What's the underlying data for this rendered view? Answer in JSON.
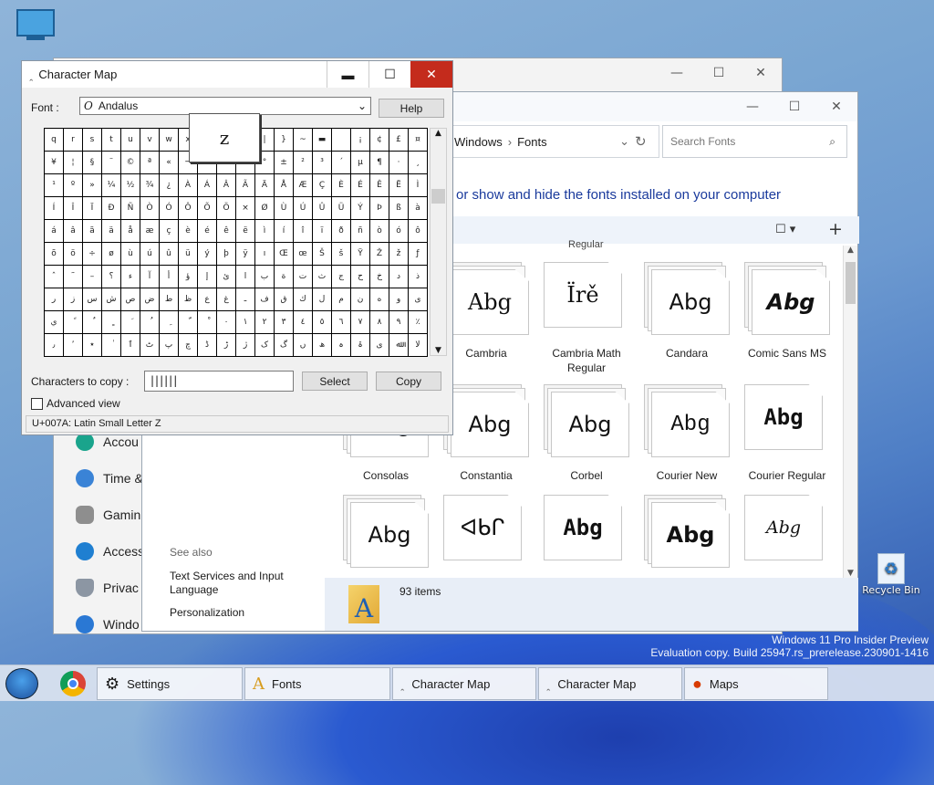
{
  "desktop": {
    "icons": [
      {
        "name": "This PC"
      },
      {
        "name": "Recycle Bin"
      }
    ],
    "watermark": {
      "line1": "Windows 11 Pro Insider Preview",
      "line2": "Evaluation copy. Build 25947.rs_prerelease.230901-1416"
    }
  },
  "settings_window": {
    "nav": [
      {
        "label": "Accou"
      },
      {
        "label": "Time &"
      },
      {
        "label": "Gamin"
      },
      {
        "label": "Access"
      },
      {
        "label": "Privac"
      },
      {
        "label": "Windo"
      }
    ]
  },
  "fonts_window": {
    "breadcrumb": [
      "Windows",
      "Fonts"
    ],
    "search_placeholder": "Search Fonts",
    "heading": "or show and hide the fonts installed on your computer",
    "partial_label": "Regular",
    "fonts": [
      {
        "sample": "Abg",
        "name": "Cambria"
      },
      {
        "sample": "Ïrě",
        "name": "Cambria Math Regular"
      },
      {
        "sample": "Abg",
        "name": "Candara"
      },
      {
        "sample": "Abg",
        "name": "Comic Sans MS"
      },
      {
        "sample": "Abg",
        "name": "Consolas"
      },
      {
        "sample": "Abg",
        "name": "Constantia"
      },
      {
        "sample": "Abg",
        "name": "Corbel"
      },
      {
        "sample": "Abg",
        "name": "Courier New"
      },
      {
        "sample": "Abg",
        "name": "Courier Regular"
      },
      {
        "sample": "Abg",
        "name": ""
      },
      {
        "sample": "ᐊᑲᒋ",
        "name": ""
      },
      {
        "sample": "Abg",
        "name": ""
      },
      {
        "sample": "Abg",
        "name": ""
      },
      {
        "sample": "Abg",
        "name": ""
      }
    ],
    "see_also": {
      "title": "See also",
      "links": [
        "Text Services and Input Language",
        "Personalization"
      ]
    },
    "status_count": "93 items"
  },
  "charmap": {
    "title": "Character Map",
    "font_label": "Font :",
    "font_value": "Andalus",
    "help": "Help",
    "zoom_char": "z",
    "grid": [
      [
        "q",
        "r",
        "s",
        "t",
        "u",
        "v",
        "w",
        "x",
        "y",
        "z",
        "{",
        "|",
        "}",
        "~",
        "▬",
        "",
        "¡",
        "¢",
        "£",
        "¤"
      ],
      [
        "¥",
        "¦",
        "§",
        "¨",
        "©",
        "ª",
        "«",
        "¬",
        "-",
        "®",
        "¯",
        "°",
        "±",
        "²",
        "³",
        "´",
        "µ",
        "¶",
        "·",
        "¸"
      ],
      [
        "¹",
        "º",
        "»",
        "¼",
        "½",
        "¾",
        "¿",
        "À",
        "Á",
        "Â",
        "Ã",
        "Ä",
        "Å",
        "Æ",
        "Ç",
        "È",
        "É",
        "Ê",
        "Ë",
        "Ì"
      ],
      [
        "Í",
        "Î",
        "Ï",
        "Ð",
        "Ñ",
        "Ò",
        "Ó",
        "Ô",
        "Õ",
        "Ö",
        "×",
        "Ø",
        "Ù",
        "Ú",
        "Û",
        "Ü",
        "Ý",
        "Þ",
        "ß",
        "à"
      ],
      [
        "á",
        "â",
        "ã",
        "ä",
        "å",
        "æ",
        "ç",
        "è",
        "é",
        "ê",
        "ë",
        "ì",
        "í",
        "î",
        "ï",
        "ð",
        "ñ",
        "ò",
        "ó",
        "ô"
      ],
      [
        "õ",
        "ö",
        "÷",
        "ø",
        "ù",
        "ú",
        "û",
        "ü",
        "ý",
        "þ",
        "ÿ",
        "ı",
        "Œ",
        "œ",
        "Š",
        "š",
        "Ÿ",
        "Ž",
        "ž",
        "ƒ"
      ],
      [
        "ˆ",
        "˜",
        "–",
        "؟",
        "ء",
        "آ",
        "أ",
        "ؤ",
        "إ",
        "ئ",
        "ا",
        "ب",
        "ة",
        "ت",
        "ث",
        "ج",
        "ح",
        "خ",
        "د",
        "ذ"
      ],
      [
        "ر",
        "ز",
        "س",
        "ش",
        "ص",
        "ض",
        "ط",
        "ظ",
        "ع",
        "غ",
        "ـ",
        "ف",
        "ق",
        "ك",
        "ل",
        "م",
        "ن",
        "ه",
        "و",
        "ى"
      ],
      [
        "ي",
        "ً",
        "ٌ",
        "ٍ",
        "َ",
        "ُ",
        "ِ",
        "ّ",
        "ْ",
        "٠",
        "١",
        "٢",
        "٣",
        "٤",
        "٥",
        "٦",
        "٧",
        "٨",
        "٩",
        "٪"
      ],
      [
        "٫",
        "٬",
        "٭",
        "ٰ",
        "ٱ",
        "ٹ",
        "پ",
        "چ",
        "ڈ",
        "ڑ",
        "ژ",
        "ک",
        "گ",
        "ں",
        "ھ",
        "ہ",
        "ۃ",
        "ی",
        "ﷲ",
        "ﻻ"
      ]
    ],
    "copy_label": "Characters to copy :",
    "copy_value": "||||||",
    "select": "Select",
    "copy": "Copy",
    "advanced": "Advanced view",
    "status": "U+007A: Latin Small Letter Z"
  },
  "taskbar": {
    "items": [
      {
        "label": "Settings"
      },
      {
        "label": "Fonts"
      },
      {
        "label": "Character Map"
      },
      {
        "label": "Character Map"
      },
      {
        "label": "Maps"
      }
    ]
  }
}
